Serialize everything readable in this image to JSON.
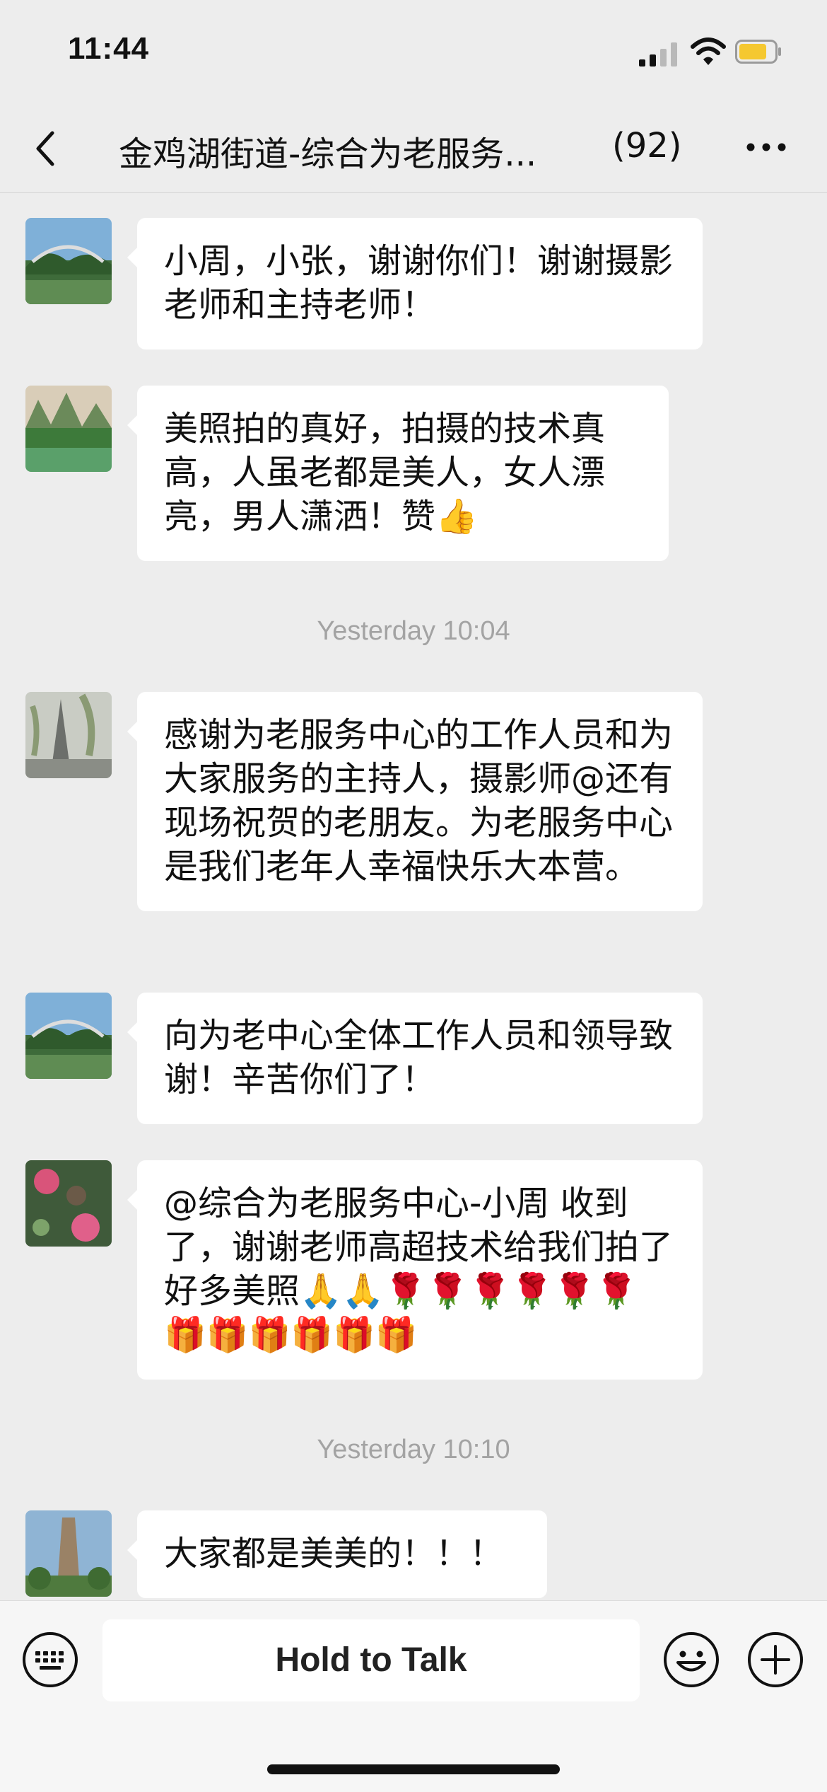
{
  "status_bar": {
    "time": "11:44"
  },
  "header": {
    "title": "金鸡湖街道-综合为老服务...",
    "member_count": "(92)"
  },
  "messages": [
    {
      "text": "小周，小张，谢谢你们！谢谢摄影老师和主持老师！"
    },
    {
      "text": "美照拍的真好，拍摄的技术真高，人虽老都是美人，女人漂亮，男人潇洒！赞👍"
    },
    {
      "text": "感谢为老服务中心的工作人员和为大家服务的主持人，摄影师@还有现场祝贺的老朋友。为老服务中心是我们老年人幸福快乐大本营。"
    },
    {
      "text": "向为老中心全体工作人员和领导致谢！辛苦你们了！"
    },
    {
      "text": "@综合为老服务中心-小周 收到了，谢谢老师高超技术给我们拍了好多美照🙏🙏🌹🌹🌹🌹🌹🌹🎁🎁🎁🎁🎁🎁"
    },
    {
      "text": "大家都是美美的！！！"
    }
  ],
  "timestamps": [
    "Yesterday 10:04",
    "Yesterday 10:10"
  ],
  "input_bar": {
    "hold_to_talk": "Hold to Talk"
  },
  "colors": {
    "background": "#ededed",
    "bubble": "#ffffff",
    "timestamp": "#a3a3a3",
    "battery": "#f5c830"
  }
}
